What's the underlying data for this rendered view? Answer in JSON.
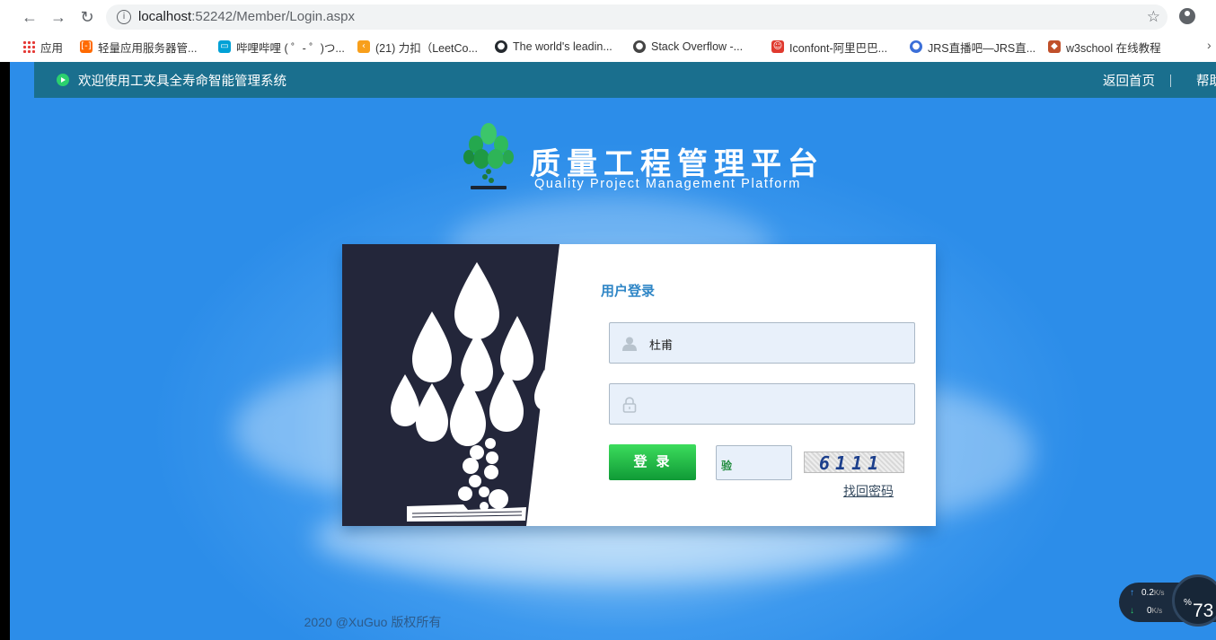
{
  "browser": {
    "url_host": "localhost",
    "url_rest": ":52242/Member/Login.aspx",
    "bookmarks": [
      {
        "label": "应用",
        "icon": "apps-grid-icon",
        "color": "#e53935"
      },
      {
        "label": "轻量应用服务器管...",
        "icon": "aliyun-icon",
        "color": "#ff6a00"
      },
      {
        "label": "哔哩哔哩 ( ゜- ゜)つ...",
        "icon": "bilibili-icon",
        "color": "#00a1d6"
      },
      {
        "label": "(21) 力扣（LeetCo...",
        "icon": "leetcode-icon",
        "color": "#f89f1b"
      },
      {
        "label": "The world's leadin...",
        "icon": "github-icon",
        "color": "#24292e"
      },
      {
        "label": "Stack Overflow -...",
        "icon": "stackoverflow-icon",
        "color": "#444444"
      },
      {
        "label": "Iconfont-阿里巴巴...",
        "icon": "iconfont-icon",
        "color": "#e03a2f"
      },
      {
        "label": "JRS直播吧—JRS直...",
        "icon": "jrs-icon",
        "color": "#3b6fd8"
      },
      {
        "label": "w3school 在线教程",
        "icon": "w3school-icon",
        "color": "#c0502a"
      }
    ]
  },
  "topbar": {
    "welcome": "欢迎使用工夹具全寿命智能管理系统",
    "home_link": "返回首页",
    "help_link": "帮助"
  },
  "brand": {
    "title_cn": "质量工程管理平台",
    "title_en": "Quality Project Management Platform"
  },
  "login": {
    "title": "用户登录",
    "username_value": "杜甫",
    "password_value": "",
    "button_label": "登录",
    "code_icon_text": "验",
    "captcha_text": "6111",
    "forgot_link": "找回密码"
  },
  "footer": {
    "copyright": "2020 @XuGuo 版权所有"
  },
  "speed_widget": {
    "upload": "0.2",
    "download": "0",
    "unit": "K/s",
    "percent": "73",
    "percent_unit": "%"
  }
}
